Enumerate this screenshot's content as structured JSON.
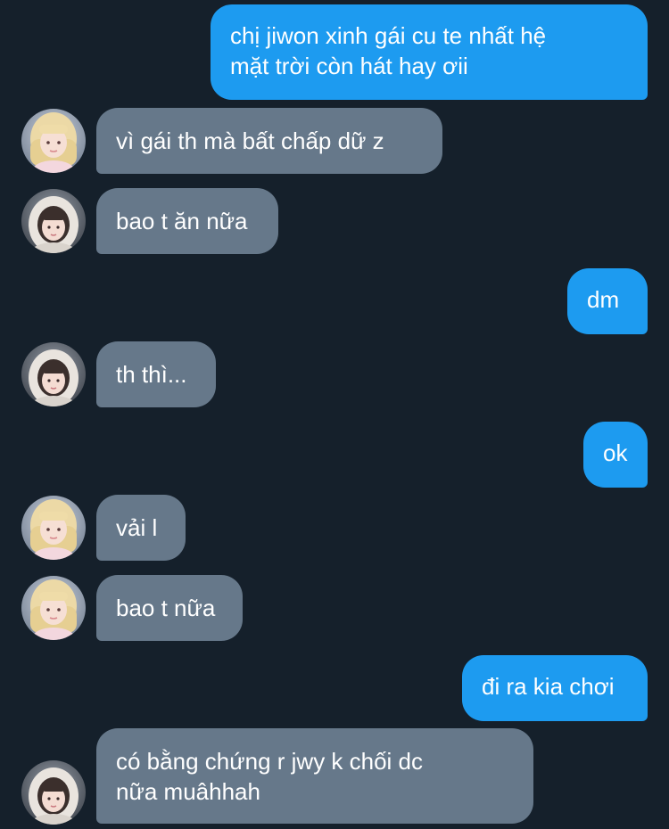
{
  "conversation": {
    "messages": [
      {
        "side": "sent",
        "text": "chị jiwon xinh gái cu te nhất hệ\nmặt trời còn hát hay ơii"
      },
      {
        "side": "received",
        "avatar": "blonde-girl-avatar",
        "text": "vì gái th mà bất chấp dữ z"
      },
      {
        "side": "received",
        "avatar": "hooded-girl-avatar",
        "text": "bao t ăn nữa"
      },
      {
        "side": "sent",
        "text": "dm"
      },
      {
        "side": "received",
        "avatar": "hooded-girl-avatar",
        "text": "th thì..."
      },
      {
        "side": "sent",
        "text": "ok"
      },
      {
        "side": "received",
        "avatar": "blonde-girl-avatar",
        "text": "vải l"
      },
      {
        "side": "received",
        "avatar": "blonde-girl-avatar",
        "text": "bao t nữa"
      },
      {
        "side": "sent",
        "text": "đi ra kia chơi"
      },
      {
        "side": "received",
        "avatar": "hooded-girl-avatar",
        "text": "có bằng chứng r jwy k chối dc\nnữa muâhhah"
      }
    ]
  },
  "colors": {
    "background": "#15202b",
    "sent_bubble": "#1d9bf0",
    "received_bubble": "#66788a",
    "text": "#ffffff"
  }
}
